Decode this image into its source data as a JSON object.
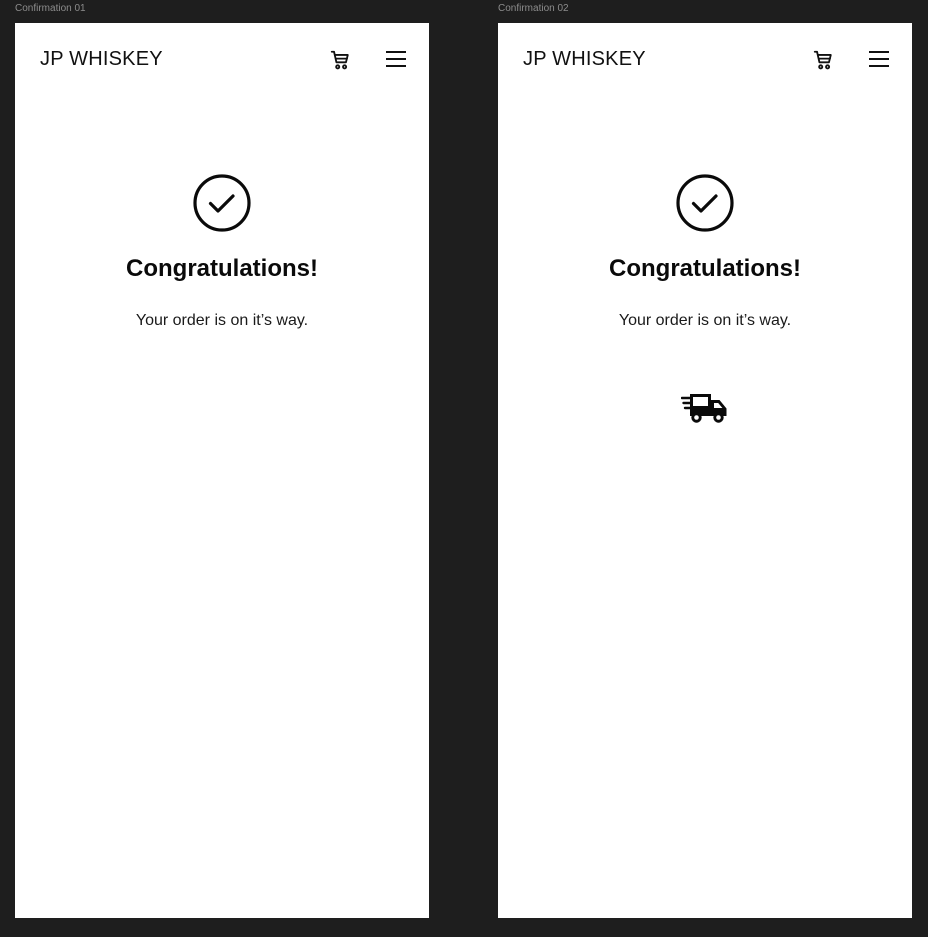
{
  "frames": [
    {
      "label": "Confirmation 01",
      "brand": "JP WHISKEY",
      "cart_icon": "cart-icon",
      "menu_icon": "hamburger-menu-icon",
      "status_icon": "check-circle-icon",
      "title": "Congratulations!",
      "message": "Your order is on it’s way."
    },
    {
      "label": "Confirmation 02",
      "brand": "JP WHISKEY",
      "cart_icon": "cart-icon",
      "menu_icon": "hamburger-menu-icon",
      "status_icon": "check-circle-icon",
      "title": "Congratulations!",
      "message": "Your order is on it’s way.",
      "delivery_icon": "delivery-truck-icon"
    }
  ],
  "colors": {
    "canvas_background": "#1e1e1e",
    "frame_background": "#ffffff",
    "text_primary": "#111111",
    "frame_label": "#8c8c8c"
  }
}
